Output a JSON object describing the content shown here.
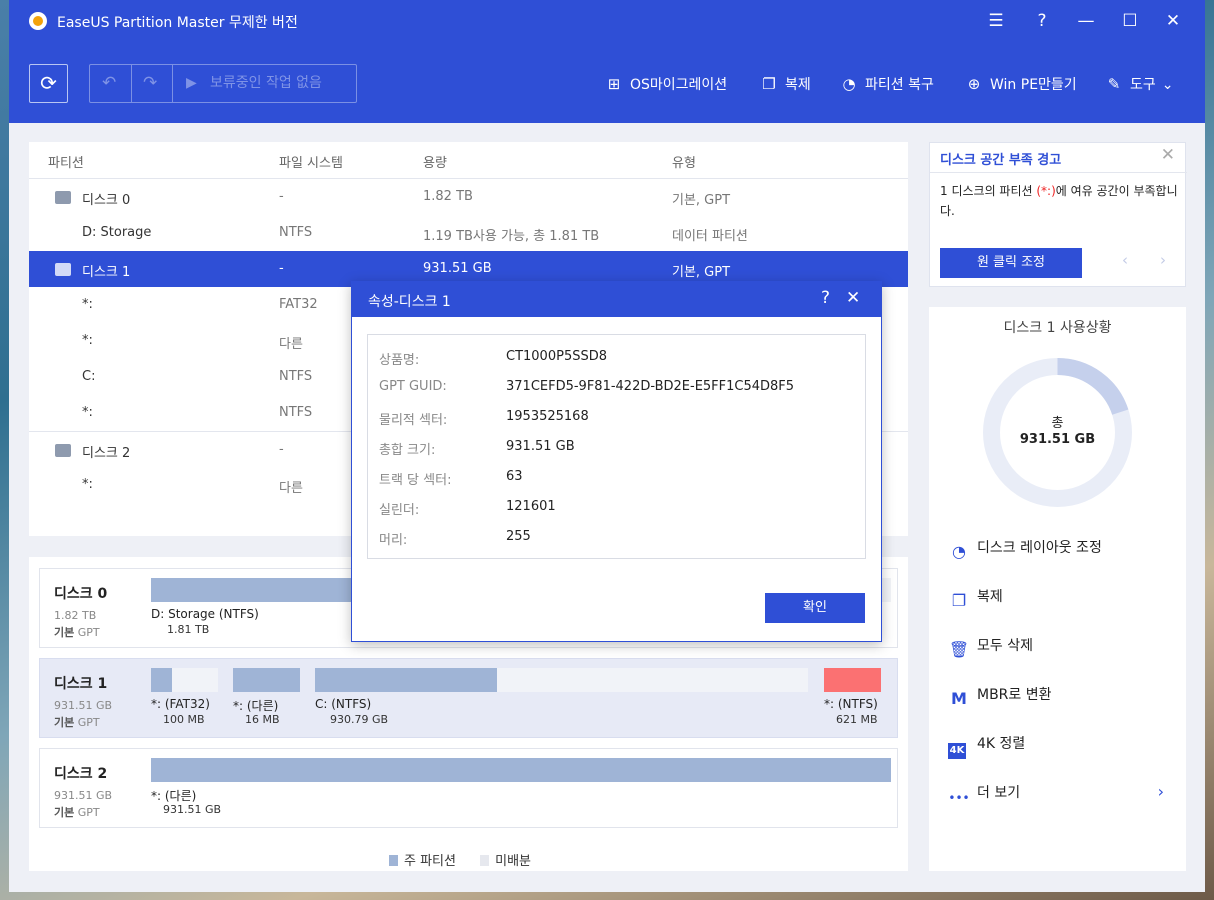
{
  "app": {
    "title": "EaseUS Partition Master 무제한 버전"
  },
  "window_controls": {
    "menu": "☰",
    "help": "?",
    "minimize": "—",
    "maximize": "☐",
    "close": "✕"
  },
  "toolbar": {
    "refresh_icon": "⟳",
    "undo_icon": "↶",
    "redo_icon": "↷",
    "play_icon": "▶",
    "pending_text": "보류중인 작업 없음",
    "os_migration": "OS마이그레이션",
    "clone": "복제",
    "partition_recovery": "파티션 복구",
    "winpe": "Win PE만들기",
    "tools": "도구"
  },
  "table": {
    "headers": {
      "partition": "파티션",
      "fs": "파일 시스템",
      "capacity": "용량",
      "type": "유형"
    },
    "rows": [
      {
        "name": "디스크 0",
        "fs": "-",
        "capacity": "1.82 TB",
        "type": "기본, GPT"
      },
      {
        "name": "D: Storage",
        "fs": "NTFS",
        "capacity": "1.19 TB사용 가능,  총 1.81 TB",
        "type": "데이터 파티션"
      },
      {
        "name": "디스크 1",
        "fs": "-",
        "capacity": "931.51 GB",
        "type": "기본, GPT"
      },
      {
        "name": "*:",
        "fs": "FAT32",
        "capacity": "",
        "type": ""
      },
      {
        "name": "*:",
        "fs": "다른",
        "capacity": "",
        "type": ""
      },
      {
        "name": "C:",
        "fs": "NTFS",
        "capacity": "",
        "type": ""
      },
      {
        "name": "*:",
        "fs": "NTFS",
        "capacity": "",
        "type": ""
      },
      {
        "name": "디스크 2",
        "fs": "-",
        "capacity": "",
        "type": ""
      },
      {
        "name": "*:",
        "fs": "다른",
        "capacity": "",
        "type": ""
      }
    ]
  },
  "diskmap": {
    "disks": [
      {
        "name": "디스크 0",
        "size": "1.82 TB",
        "type_bold": "기본",
        "type_rest": "GPT",
        "partitions": [
          {
            "label": "D: Storage (NTFS)",
            "size": "1.81 TB",
            "used_fraction": 0.35
          }
        ]
      },
      {
        "name": "디스크 1",
        "size": "931.51 GB",
        "type_bold": "기본",
        "type_rest": "GPT",
        "partitions": [
          {
            "label": "*: (FAT32)",
            "size": "100 MB",
            "used_fraction": 0.32
          },
          {
            "label": "*: (다른)",
            "size": "16 MB",
            "used_fraction": 1.0
          },
          {
            "label": "C: (NTFS)",
            "size": "930.79 GB",
            "used_fraction": 0.37
          },
          {
            "label": "*: (NTFS)",
            "size": "621 MB",
            "used_fraction": 1.0
          }
        ]
      },
      {
        "name": "디스크 2",
        "size": "931.51 GB",
        "type_bold": "기본",
        "type_rest": "GPT",
        "partitions": [
          {
            "label": "*: (다른)",
            "size": "931.51 GB",
            "used_fraction": 1.0
          }
        ]
      }
    ],
    "legend": {
      "primary": "주 파티션",
      "unallocated": "미배분"
    }
  },
  "warning": {
    "title": "디스크 공간 부족 경고",
    "close": "✕",
    "text_before": "1 디스크의 파티션 ",
    "text_highlight": "(*:)",
    "text_after": "에 여유 공간이 부족합니다.",
    "button": "원 클릭 조정",
    "prev": "‹",
    "next": "›"
  },
  "usage": {
    "title": "디스크 1 사용상황",
    "total_label": "총",
    "total_value": "931.51 GB",
    "used_fraction": 0.2,
    "actions": [
      {
        "icon": "pie-chart-icon",
        "glyph": "◔",
        "label": "디스크 레이아웃 조정"
      },
      {
        "icon": "clone-icon",
        "glyph": "❐",
        "label": "복제"
      },
      {
        "icon": "trash-icon",
        "glyph": "🗑",
        "label": "모두 삭제"
      },
      {
        "icon": "mbr-convert-icon",
        "glyph": "M",
        "label": "MBR로 변환"
      },
      {
        "icon": "4k-align-icon",
        "glyph": "4K",
        "label": "4K 정렬"
      },
      {
        "icon": "more-icon",
        "glyph": "•••",
        "label": "더 보기"
      }
    ],
    "more_arrow": "›"
  },
  "dialog": {
    "title": "속성-디스크 1",
    "help": "?",
    "close": "✕",
    "properties": [
      {
        "key": "상품명:",
        "value": "CT1000P5SSD8"
      },
      {
        "key": "GPT GUID:",
        "value": "371CEFD5-9F81-422D-BD2E-E5FF1C54D8F5"
      },
      {
        "key": "물리적 섹터:",
        "value": "1953525168"
      },
      {
        "key": "총합 크기:",
        "value": "931.51 GB"
      },
      {
        "key": "트랙 당 섹터:",
        "value": "63"
      },
      {
        "key": "실린더:",
        "value": "121601"
      },
      {
        "key": "머리:",
        "value": "255"
      }
    ],
    "ok": "확인"
  },
  "colors": {
    "accent": "#2f4fd6",
    "partition_fill": "#9fb4d6",
    "warning_fill": "#fb7172"
  }
}
